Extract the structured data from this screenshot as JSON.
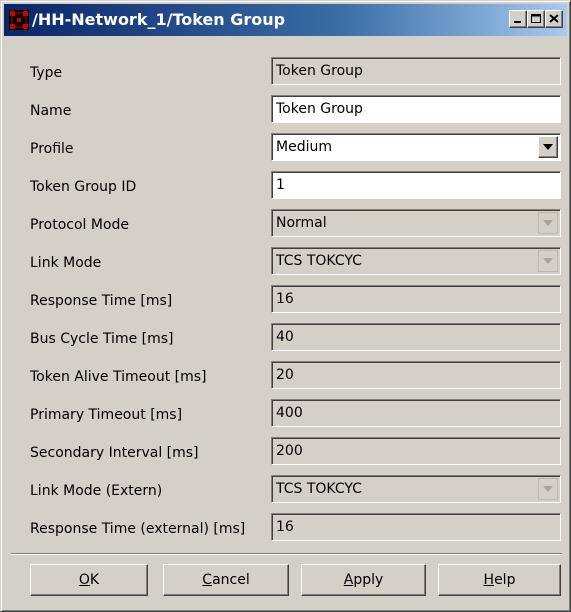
{
  "window": {
    "title": "/HH-Network_1/Token Group",
    "title_icon": "network-grid-icon",
    "controls": [
      "minimize-icon",
      "maximize-icon",
      "close-icon"
    ]
  },
  "fields": [
    {
      "label": "Type",
      "value": "Token Group",
      "kind": "readonly"
    },
    {
      "label": "Name",
      "value": "Token Group",
      "kind": "text"
    },
    {
      "label": "Profile",
      "value": "Medium",
      "kind": "combo"
    },
    {
      "label": "Token Group ID",
      "value": "1",
      "kind": "text"
    },
    {
      "label": "Protocol Mode",
      "value": "Normal",
      "kind": "combo-disabled"
    },
    {
      "label": "Link Mode",
      "value": "TCS TOKCYC",
      "kind": "combo-disabled"
    },
    {
      "label": "Response Time [ms]",
      "value": "16",
      "kind": "readonly"
    },
    {
      "label": "Bus Cycle Time [ms]",
      "value": "40",
      "kind": "readonly"
    },
    {
      "label": "Token Alive Timeout [ms]",
      "value": "20",
      "kind": "readonly"
    },
    {
      "label": "Primary Timeout [ms]",
      "value": "400",
      "kind": "readonly"
    },
    {
      "label": "Secondary Interval [ms]",
      "value": "200",
      "kind": "readonly"
    },
    {
      "label": "Link Mode (Extern)",
      "value": "TCS TOKCYC",
      "kind": "combo-disabled"
    },
    {
      "label": "Response Time (external) [ms]",
      "value": "16",
      "kind": "readonly"
    }
  ],
  "buttons": {
    "ok": {
      "mnemonic": "O",
      "rest": "K"
    },
    "cancel": {
      "mnemonic": "C",
      "rest": "ancel"
    },
    "apply": {
      "mnemonic": "A",
      "rest": "pply"
    },
    "help": {
      "mnemonic": "H",
      "rest": "elp"
    }
  },
  "colors": {
    "face": "#d4d0c8",
    "title_start": "#0a246a",
    "title_end": "#a6caf0",
    "icon_red": "#cc0000"
  }
}
